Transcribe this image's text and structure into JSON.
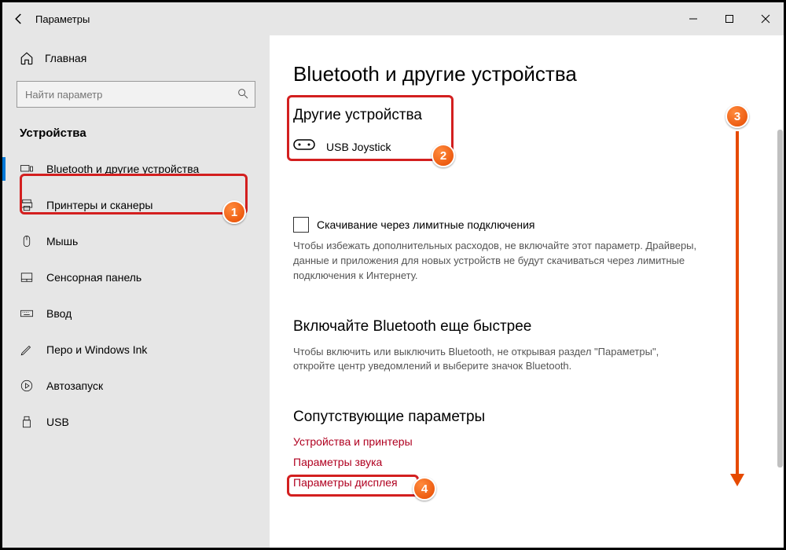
{
  "window": {
    "title": "Параметры"
  },
  "sidebar": {
    "home": "Главная",
    "search_placeholder": "Найти параметр",
    "section": "Устройства",
    "items": [
      {
        "label": "Bluetooth и другие устройства"
      },
      {
        "label": "Принтеры и сканеры"
      },
      {
        "label": "Мышь"
      },
      {
        "label": "Сенсорная панель"
      },
      {
        "label": "Ввод"
      },
      {
        "label": "Перо и Windows Ink"
      },
      {
        "label": "Автозапуск"
      },
      {
        "label": "USB"
      }
    ]
  },
  "main": {
    "title": "Bluetooth и другие устройства",
    "other_devices_header": "Другие устройства",
    "device_name": "USB  Joystick",
    "metered_checkbox": "Скачивание через лимитные подключения",
    "metered_desc": "Чтобы избежать дополнительных расходов, не включайте этот параметр. Драйверы, данные и приложения для новых устройств не будут скачиваться через лимитные подключения к Интернету.",
    "quick_header": "Включайте Bluetooth еще быстрее",
    "quick_desc": "Чтобы включить или выключить Bluetooth, не открывая раздел \"Параметры\", откройте центр уведомлений и выберите значок Bluetooth.",
    "related_header": "Сопутствующие параметры",
    "links": [
      "Устройства и принтеры",
      "Параметры звука",
      "Параметры дисплея"
    ]
  },
  "annotations": {
    "b1": "1",
    "b2": "2",
    "b3": "3",
    "b4": "4"
  }
}
